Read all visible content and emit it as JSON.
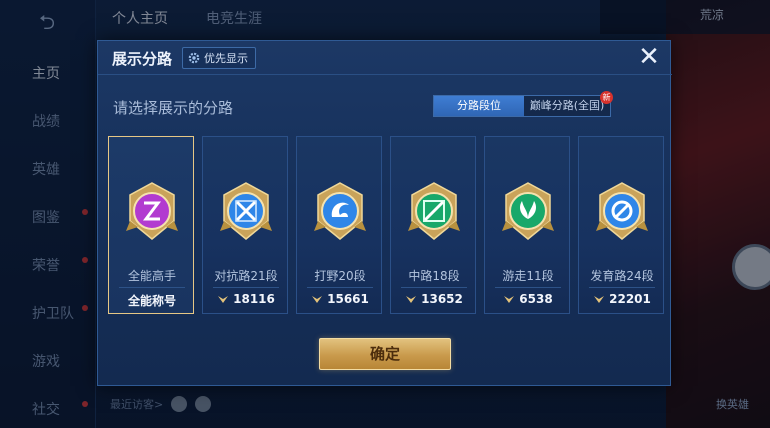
{
  "background": {
    "back_glyph": "⮌",
    "nav": [
      {
        "label": "主页",
        "active": true
      },
      {
        "label": "战绩"
      },
      {
        "label": "英雄"
      },
      {
        "label": "图鉴",
        "dot": true
      },
      {
        "label": "荣誉",
        "dot": true
      },
      {
        "label": "护卫队",
        "dot": true
      },
      {
        "label": "游戏"
      },
      {
        "label": "社交",
        "dot": true
      }
    ],
    "top_tabs": [
      "个人主页",
      "电竞生涯"
    ],
    "recent_visitors": "最近访客>",
    "right_label": "换英雄",
    "right_name": "荒凉"
  },
  "dialog": {
    "title": "展示分路",
    "priority_label": "优先显示",
    "close_glyph": "✕",
    "subtitle": "请选择展示的分路",
    "tabs": [
      {
        "label": "分路段位",
        "active": true
      },
      {
        "label": "巅峰分路(全国)",
        "badge": "新"
      }
    ],
    "lanes": [
      {
        "name": "全能高手",
        "score": "全能称号",
        "selected": true,
        "color": "#b23bd0",
        "icon": "allround-emblem-icon"
      },
      {
        "name": "对抗路21段",
        "score": "18116",
        "color": "#2f86e8",
        "icon": "clash-lane-emblem-icon"
      },
      {
        "name": "打野20段",
        "score": "15661",
        "color": "#2f86e8",
        "icon": "jungle-emblem-icon"
      },
      {
        "name": "中路18段",
        "score": "13652",
        "color": "#18a86a",
        "icon": "mid-lane-emblem-icon"
      },
      {
        "name": "游走11段",
        "score": "6538",
        "color": "#18a86a",
        "icon": "roam-emblem-icon"
      },
      {
        "name": "发育路24段",
        "score": "22201",
        "color": "#2f86e8",
        "icon": "farm-lane-emblem-icon"
      }
    ],
    "confirm_label": "确定"
  },
  "colors": {
    "gold": "#e6c785",
    "dialog_bg": "#173260",
    "accent_blue": "#3f7dd3"
  }
}
